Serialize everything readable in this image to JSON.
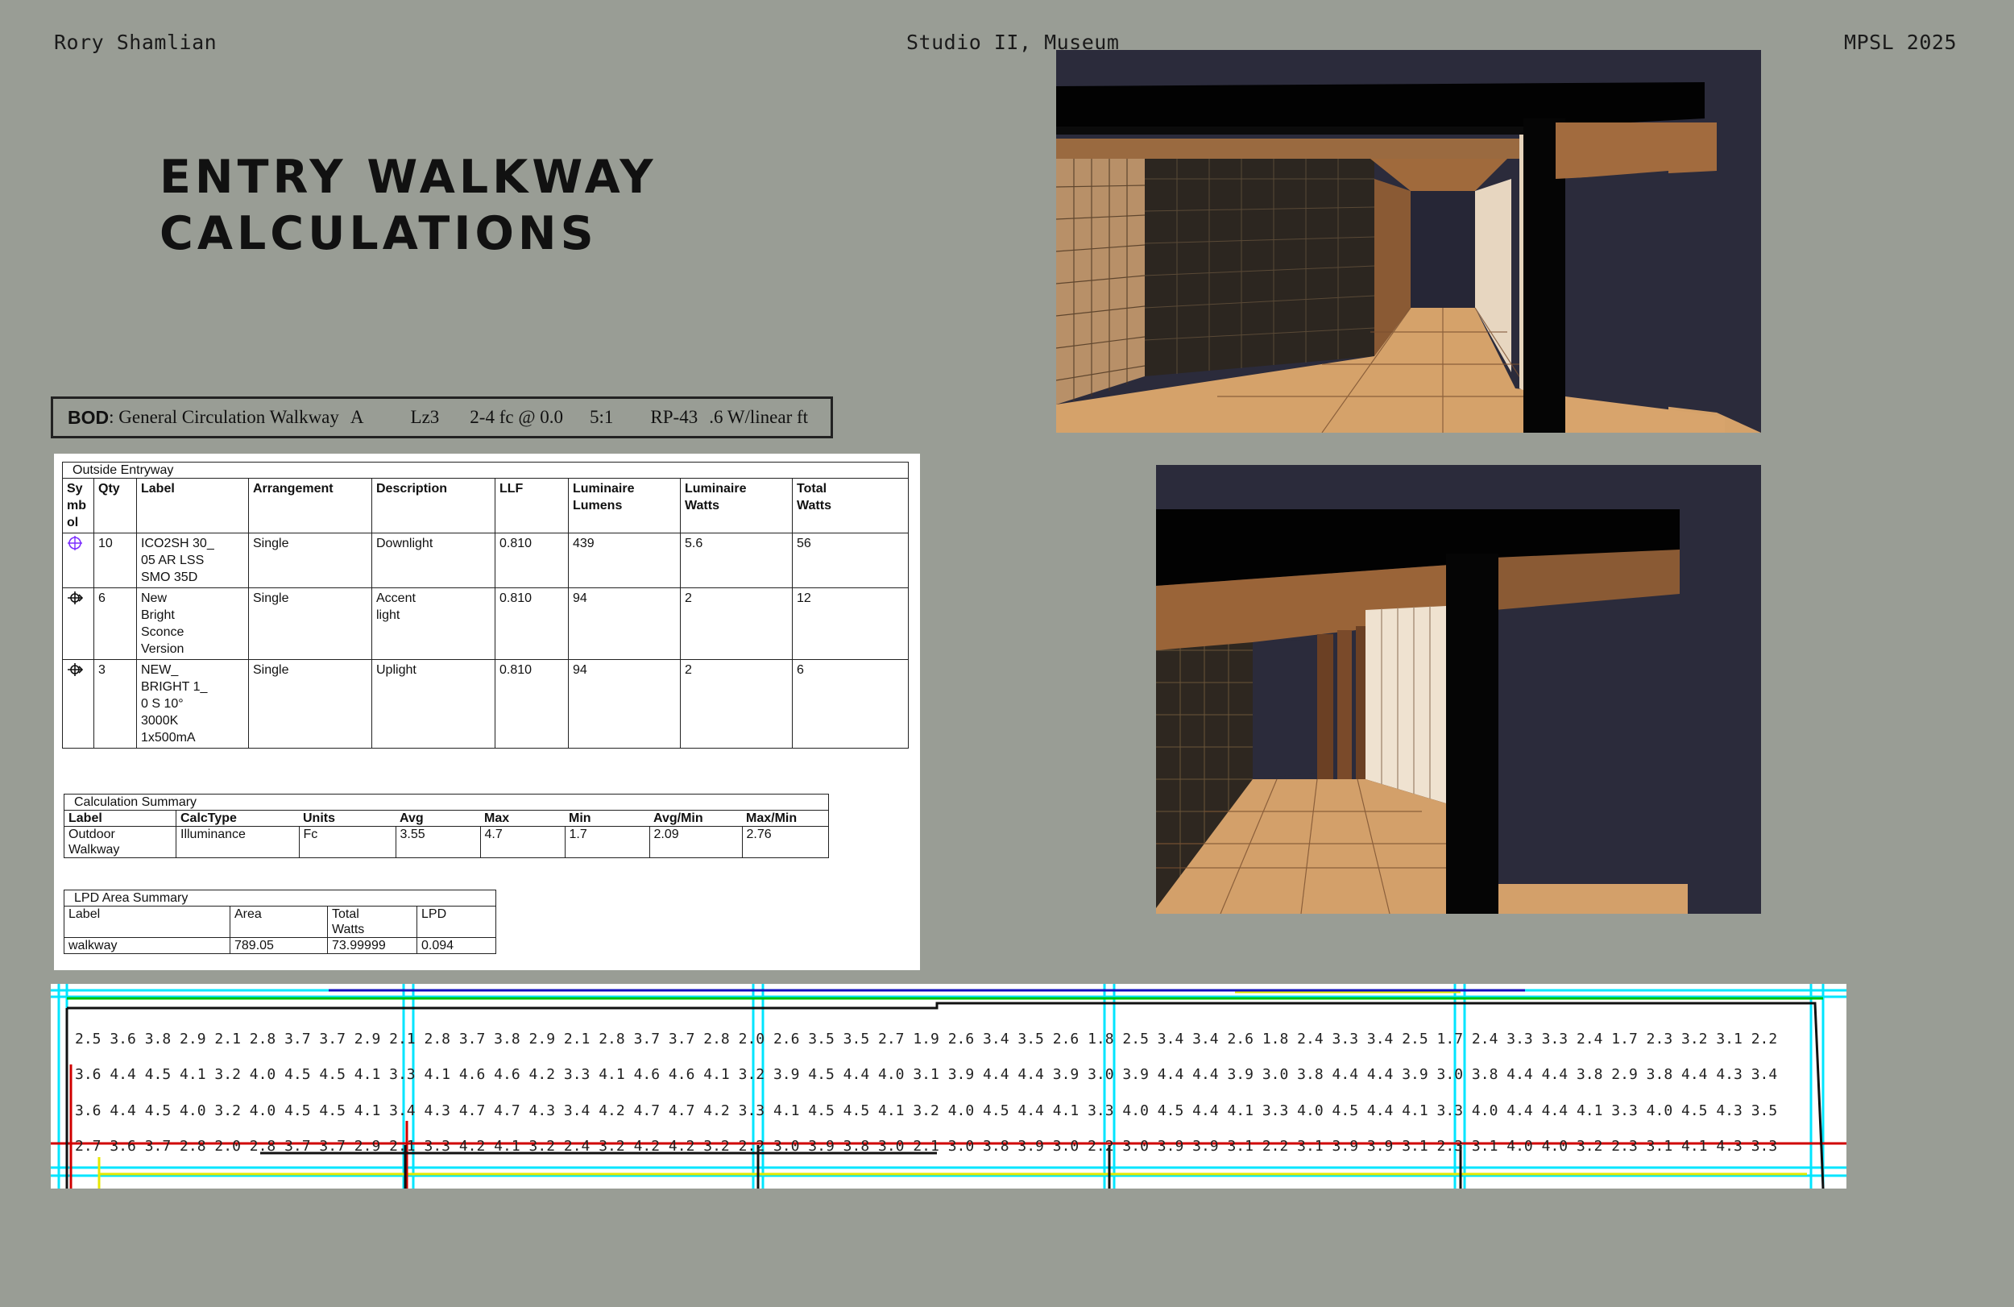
{
  "header": {
    "author": "Rory Shamlian",
    "course": "Studio II, Museum",
    "program": "MPSL 2025"
  },
  "title": {
    "line1": "ENTRY WALKWAY",
    "line2": "CALCULATIONS"
  },
  "bod": {
    "label": "BOD",
    "space": ": General Circulation Walkway",
    "class": "A",
    "zone": "Lz3",
    "target": "2-4 fc @ 0.0",
    "ratio": "5:1",
    "standard": "RP-43",
    "limit": ".6 W/linear ft"
  },
  "luminaire_table": {
    "caption": "Outside Entryway",
    "headers": [
      "Sy\nmb\nol",
      "Qty",
      "Label",
      "Arrangement",
      "Description",
      "LLF",
      "Luminaire\nLumens",
      "Luminaire\nWatts",
      "Total\nWatts"
    ],
    "rows": [
      {
        "symbol": "circle-target-purple",
        "qty": "10",
        "label": "ICO2SH 30_\n05 AR LSS\nSMO 35D",
        "arrangement": "Single",
        "description": "Downlight",
        "llf": "0.810",
        "lumens": "439",
        "watts": "5.6",
        "total": "56"
      },
      {
        "symbol": "sconce-arrow",
        "qty": "6",
        "label": "New\nBright\nSconce\nVersion",
        "arrangement": "Single",
        "description": "Accent\nlight",
        "llf": "0.810",
        "lumens": "94",
        "watts": "2",
        "total": "12"
      },
      {
        "symbol": "uplight-arrow",
        "qty": "3",
        "label": "NEW_\nBRIGHT 1_\n0 S 10°\n3000K\n1x500mA",
        "arrangement": "Single",
        "description": "Uplight",
        "llf": "0.810",
        "lumens": "94",
        "watts": "2",
        "total": "6"
      }
    ]
  },
  "calc_summary": {
    "caption": "Calculation Summary",
    "headers": [
      "Label",
      "CalcType",
      "Units",
      "Avg",
      "Max",
      "Min",
      "Avg/Min",
      "Max/Min"
    ],
    "row": [
      "Outdoor\nWalkway",
      "Illuminance",
      "Fc",
      "3.55",
      "4.7",
      "1.7",
      "2.09",
      "2.76"
    ]
  },
  "lpd_summary": {
    "caption": "LPD Area Summary",
    "headers": [
      "Label",
      "Area",
      "Total\nWatts",
      "LPD"
    ],
    "row": [
      "walkway",
      "789.05",
      "73.99999",
      "0.094"
    ]
  },
  "plan_grid": {
    "rows": [
      "2.5 3.6 3.8 2.9 2.1 2.8 3.7 3.7 2.9 2.1 2.8 3.7 3.8 2.9 2.1 2.8 3.7 3.7 2.8 2.0 2.6 3.5 3.5 2.7 1.9 2.6 3.4 3.5 2.6 1.8 2.5 3.4 3.4 2.6 1.8 2.4 3.3 3.4 2.5 1.7 2.4 3.3 3.3 2.4 1.7 2.3 3.2 3.1 2.2",
      "3.6 4.4 4.5 4.1 3.2 4.0 4.5 4.5 4.1 3.3 4.1 4.6 4.6 4.2 3.3 4.1 4.6 4.6 4.1 3.2 3.9 4.5 4.4 4.0 3.1 3.9 4.4 4.4 3.9 3.0 3.9 4.4 4.4 3.9 3.0 3.8 4.4 4.4 3.9 3.0 3.8 4.4 4.4 3.8 2.9 3.8 4.4 4.3 3.4",
      "3.6 4.4 4.5 4.0 3.2 4.0 4.5 4.5 4.1 3.4 4.3 4.7 4.7 4.3 3.4 4.2 4.7 4.7 4.2 3.3 4.1 4.5 4.5 4.1 3.2 4.0 4.5 4.4 4.1 3.3 4.0 4.5 4.4 4.1 3.3 4.0 4.5 4.4 4.1 3.3 4.0 4.4 4.4 4.1 3.3 4.0 4.5 4.3 3.5",
      "2.7 3.6 3.7 2.8 2.0 2.8 3.7 3.7 2.9 2.1 3.3 4.2 4.1 3.2 2.4 3.2 4.2 4.2 3.2 2.2 3.0 3.9 3.8 3.0 2.1 3.0 3.8 3.9 3.0 2.2 3.0 3.9 3.9 3.1 2.2 3.1 3.9 3.9 3.1 2.3 3.1 4.0 4.0 3.2 2.3 3.1 4.1 4.3 3.3"
    ]
  },
  "colors": {
    "background": "#999d95",
    "render_sky": "#2a2a3a",
    "wood": "#c8955e",
    "uplight_symbol": "#7b2cff"
  }
}
